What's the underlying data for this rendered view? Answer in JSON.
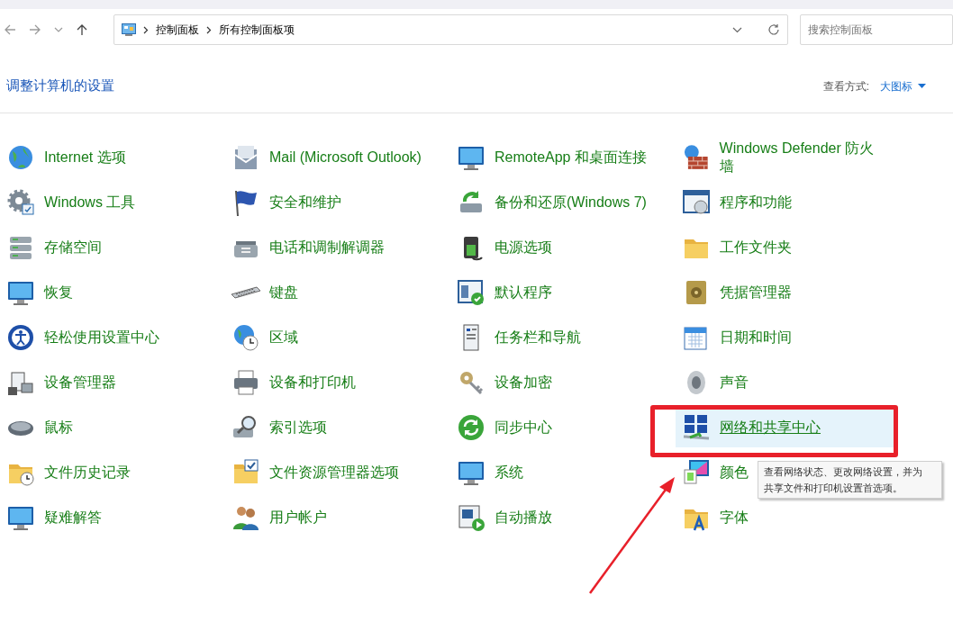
{
  "nav": {
    "breadcrumb": [
      "控制面板",
      "所有控制面板项"
    ]
  },
  "search": {
    "placeholder": "搜索控制面板"
  },
  "heading": "调整计算机的设置",
  "view_by": {
    "label": "查看方式:",
    "value": "大图标"
  },
  "items": [
    {
      "label": "Internet 选项",
      "selected": false
    },
    {
      "label": "Mail (Microsoft Outlook)",
      "selected": false
    },
    {
      "label": "RemoteApp 和桌面连接",
      "selected": false
    },
    {
      "label": "Windows Defender 防火墙",
      "selected": false
    },
    {
      "label": "Windows 工具",
      "selected": false
    },
    {
      "label": "安全和维护",
      "selected": false
    },
    {
      "label": "备份和还原(Windows 7)",
      "selected": false
    },
    {
      "label": "程序和功能",
      "selected": false
    },
    {
      "label": "存储空间",
      "selected": false
    },
    {
      "label": "电话和调制解调器",
      "selected": false
    },
    {
      "label": "电源选项",
      "selected": false
    },
    {
      "label": "工作文件夹",
      "selected": false
    },
    {
      "label": "恢复",
      "selected": false
    },
    {
      "label": "键盘",
      "selected": false
    },
    {
      "label": "默认程序",
      "selected": false
    },
    {
      "label": "凭据管理器",
      "selected": false
    },
    {
      "label": "轻松使用设置中心",
      "selected": false
    },
    {
      "label": "区域",
      "selected": false
    },
    {
      "label": "任务栏和导航",
      "selected": false
    },
    {
      "label": "日期和时间",
      "selected": false
    },
    {
      "label": "设备管理器",
      "selected": false
    },
    {
      "label": "设备和打印机",
      "selected": false
    },
    {
      "label": "设备加密",
      "selected": false
    },
    {
      "label": "声音",
      "selected": false
    },
    {
      "label": "鼠标",
      "selected": false
    },
    {
      "label": "索引选项",
      "selected": false
    },
    {
      "label": "同步中心",
      "selected": false
    },
    {
      "label": "网络和共享中心",
      "selected": true
    },
    {
      "label": "文件历史记录",
      "selected": false
    },
    {
      "label": "文件资源管理器选项",
      "selected": false
    },
    {
      "label": "系统",
      "selected": false
    },
    {
      "label": "颜色",
      "selected": false
    },
    {
      "label": "疑难解答",
      "selected": false
    },
    {
      "label": "用户帐户",
      "selected": false
    },
    {
      "label": "自动播放",
      "selected": false
    },
    {
      "label": "字体",
      "selected": false
    }
  ],
  "tooltip": {
    "lines": [
      "查看网络状态、更改网络设置，并为",
      "共享文件和打印机设置首选项。"
    ]
  }
}
